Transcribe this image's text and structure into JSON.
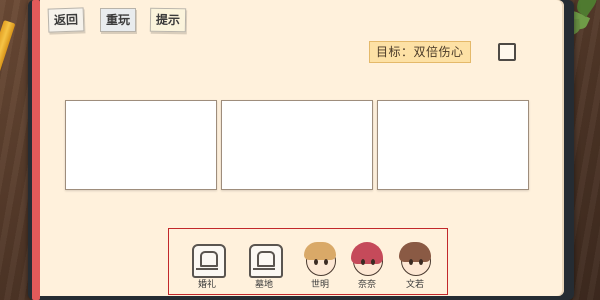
{
  "toolbar": {
    "back_label": "返回",
    "replay_label": "重玩",
    "hint_label": "提示"
  },
  "goal": {
    "label": "目标：双倍伤心",
    "completed": false
  },
  "scene_slots": [
    {
      "content": ""
    },
    {
      "content": ""
    },
    {
      "content": ""
    }
  ],
  "cards": [
    {
      "label": "婚礼",
      "icon": "wedding-tablet-icon"
    },
    {
      "label": "墓地",
      "icon": "gravestone-icon"
    },
    {
      "label": "世明",
      "icon": "boy-portrait-icon"
    },
    {
      "label": "奈奈",
      "icon": "red-hair-girl-portrait-icon"
    },
    {
      "label": "文若",
      "icon": "brown-hair-girl-portrait-icon"
    }
  ],
  "colors": {
    "paper": "#fff1dc",
    "tray_border": "#c2282a",
    "goal_bg": "#fde1a5",
    "red_hair": "#c54a5a",
    "boy_hair": "#d9a968",
    "brown_hair": "#8a5a44"
  }
}
